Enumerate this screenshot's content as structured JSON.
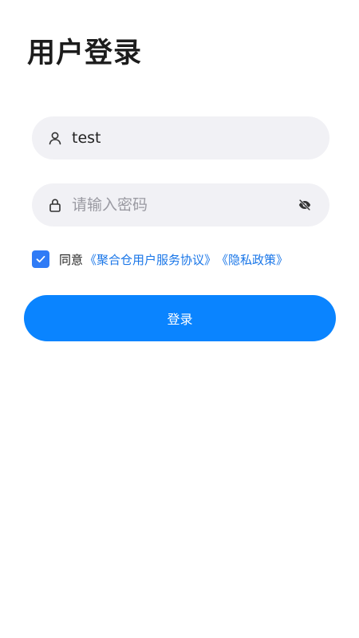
{
  "header": {
    "title": "用户登录"
  },
  "form": {
    "username_value": "test",
    "password_placeholder": "请输入密码",
    "agree_label": "同意",
    "service_agreement_link": "《聚合仓用户服务协议》",
    "privacy_policy_link": "《隐私政策》",
    "agreement_checked": true,
    "login_label": "登录"
  },
  "icons": {
    "username": "user-icon",
    "password": "lock-icon",
    "toggle_visibility": "eye-off-icon",
    "checkbox": "checkmark-icon"
  },
  "colors": {
    "primary": "#0A84FF",
    "checkbox": "#2F7BF6",
    "link": "#1976E8",
    "field_bg": "#F1F1F5",
    "title": "#1C1C1C"
  }
}
